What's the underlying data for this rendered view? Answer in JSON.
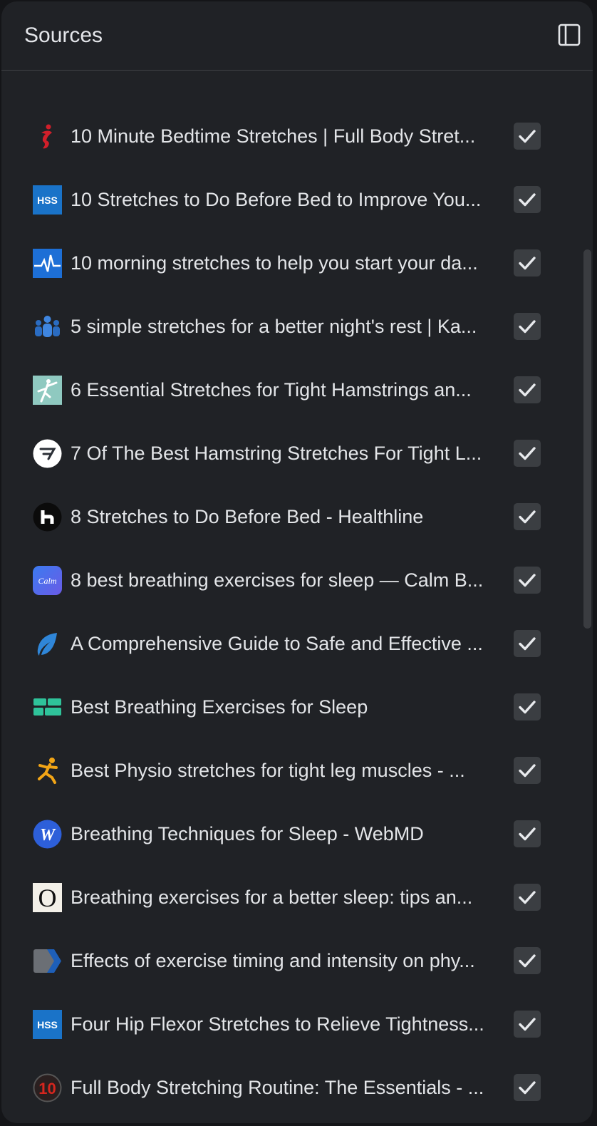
{
  "panel": {
    "title": "Sources",
    "toggle_icon": "sidebar-toggle-icon"
  },
  "colors": {
    "panel_bg": "#202226",
    "text": "#e3e5e8",
    "checkbox_bg": "#3b3e42",
    "checkmark": "#e8eaed",
    "accent_blue": "#1a73c8"
  },
  "sources": [
    {
      "title": "10 Minute Bedtime Stretches | Full Body Stret...",
      "icon": "red-figure-icon",
      "checked": true
    },
    {
      "title": "10 Stretches to Do Before Bed to Improve You...",
      "icon": "hss-logo-icon",
      "checked": true
    },
    {
      "title": "10 morning stretches to help you start your da...",
      "icon": "heartbeat-icon",
      "checked": true
    },
    {
      "title": "5 simple stretches for a better night's rest | Ka...",
      "icon": "people-group-icon",
      "checked": true
    },
    {
      "title": "6 Essential Stretches for Tight Hamstrings an...",
      "icon": "stretching-figure-icon",
      "checked": true
    },
    {
      "title": "7 Of The Best Hamstring Stretches For Tight L...",
      "icon": "circle-arrow-logo-icon",
      "checked": true
    },
    {
      "title": "8 Stretches to Do Before Bed - Healthline",
      "icon": "healthline-logo-icon",
      "checked": true
    },
    {
      "title": "8 best breathing exercises for sleep — Calm B...",
      "icon": "calm-logo-icon",
      "checked": true
    },
    {
      "title": "A Comprehensive Guide to Safe and Effective ...",
      "icon": "leaf-swirl-icon",
      "checked": true
    },
    {
      "title": "Best Breathing Exercises for Sleep",
      "icon": "green-blocks-icon",
      "checked": true
    },
    {
      "title": "Best Physio stretches for tight leg muscles - ...",
      "icon": "running-figure-icon",
      "checked": true
    },
    {
      "title": "Breathing Techniques for Sleep - WebMD",
      "icon": "webmd-logo-icon",
      "checked": true
    },
    {
      "title": "Breathing exercises for a better sleep: tips an...",
      "icon": "letter-o-logo-icon",
      "checked": true
    },
    {
      "title": "Effects of exercise timing and intensity on phy...",
      "icon": "chevron-logo-icon",
      "checked": true
    },
    {
      "title": "Four Hip Flexor Stretches to Relieve Tightness...",
      "icon": "hss-logo-icon",
      "checked": true
    },
    {
      "title": "Full Body Stretching Routine: The Essentials - ...",
      "icon": "number-ten-logo-icon",
      "checked": true
    }
  ],
  "logo_text": {
    "hss": "HSS",
    "calm": "Calm",
    "webmd": "W",
    "letter_o": "O",
    "ten": "10"
  }
}
